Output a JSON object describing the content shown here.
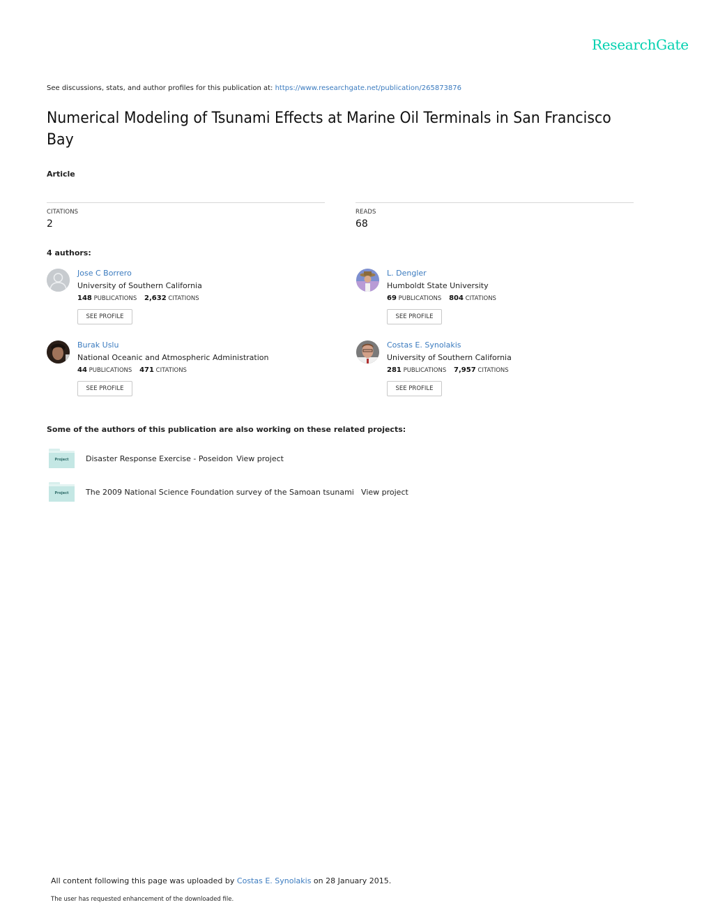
{
  "brand": {
    "logo_text": "ResearchGate",
    "accent_color": "#00d0af",
    "link_color": "#3b7bbf"
  },
  "header": {
    "see_text": "See discussions, stats, and author profiles for this publication at:",
    "url": "https://www.researchgate.net/publication/265873876"
  },
  "publication": {
    "title": "Numerical Modeling of Tsunami Effects at Marine Oil Terminals in San Francisco Bay",
    "type": "Article"
  },
  "stats": {
    "citations_label": "CITATIONS",
    "citations_value": "2",
    "reads_label": "READS",
    "reads_value": "68"
  },
  "authors_heading": "4 authors:",
  "authors": [
    {
      "name": "Jose C Borrero",
      "institution": "University of Southern California",
      "publications": "148",
      "publications_label": "PUBLICATIONS",
      "citations": "2,632",
      "citations_label": "CITATIONS",
      "button": "SEE PROFILE",
      "avatar": "default-avatar"
    },
    {
      "name": "L. Dengler",
      "institution": "Humboldt State University",
      "publications": "69",
      "publications_label": "PUBLICATIONS",
      "citations": "804",
      "citations_label": "CITATIONS",
      "button": "SEE PROFILE",
      "avatar": "photo"
    },
    {
      "name": "Burak Uslu",
      "institution": "National Oceanic and Atmospheric Administration",
      "publications": "44",
      "publications_label": "PUBLICATIONS",
      "citations": "471",
      "citations_label": "CITATIONS",
      "button": "SEE PROFILE",
      "avatar": "photo"
    },
    {
      "name": "Costas E. Synolakis",
      "institution": "University of Southern California",
      "publications": "281",
      "publications_label": "PUBLICATIONS",
      "citations": "7,957",
      "citations_label": "CITATIONS",
      "button": "SEE PROFILE",
      "avatar": "photo"
    }
  ],
  "projects_heading": "Some of the authors of this publication are also working on these related projects:",
  "projects": [
    {
      "icon_label": "Project",
      "title": "Disaster Response Exercise - Poseidon",
      "link": "View project"
    },
    {
      "icon_label": "Project",
      "title": "The 2009 National Science Foundation survey of the Samoan tsunami",
      "link": "View project"
    }
  ],
  "footer": {
    "uploaded_prefix": "All content following this page was uploaded by",
    "uploader": "Costas E. Synolakis",
    "uploaded_suffix": "on 28 January 2015.",
    "note": "The user has requested enhancement of the downloaded file."
  }
}
